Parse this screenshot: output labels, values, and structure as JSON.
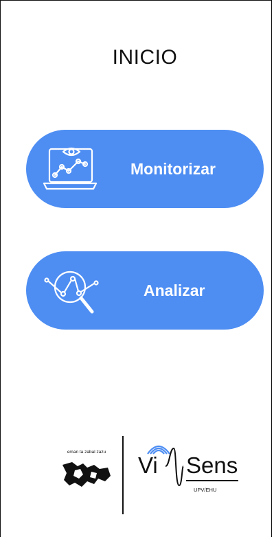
{
  "header": {
    "title": "INICIO"
  },
  "actions": [
    {
      "label": "Monitorizar",
      "icon": "laptop-eye-chart-icon"
    },
    {
      "label": "Analizar",
      "icon": "magnifier-network-icon"
    }
  ],
  "footer": {
    "ehu_motto": "eman ta zabal zazu",
    "visens_left": "Vi",
    "visens_right": "Sens",
    "visens_sub": "UPV/EHU"
  },
  "colors": {
    "button_bg": "#4e8ef3",
    "button_text": "#ffffff",
    "visens_accent": "#4e8ef3"
  }
}
